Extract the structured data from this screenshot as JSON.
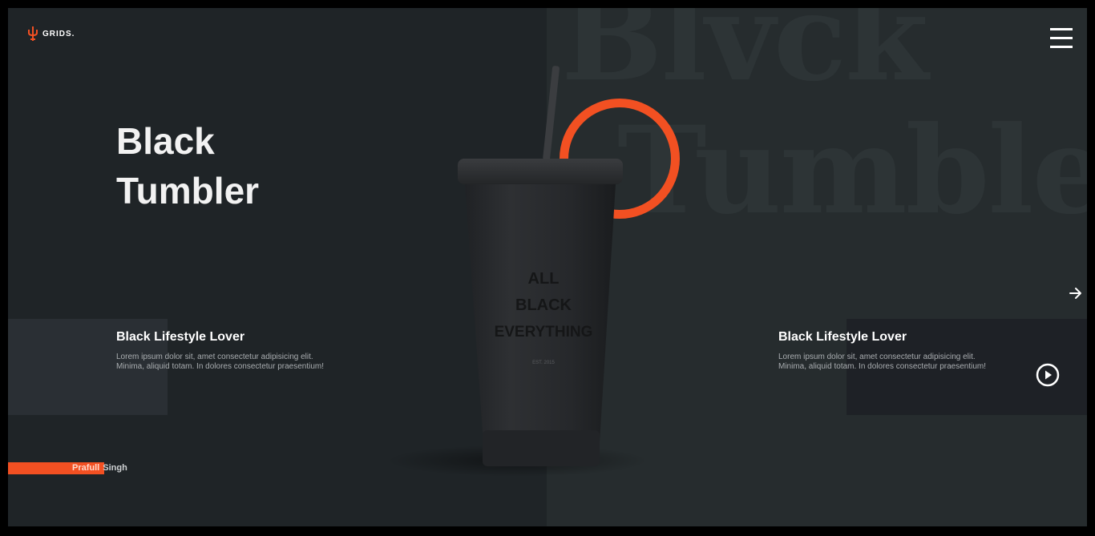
{
  "brand": {
    "name": "GRIDS.",
    "accent_color": "#f25022"
  },
  "background_words": [
    "Blvck",
    "Tumbler"
  ],
  "hero": {
    "title_line1": "Black",
    "title_line2": "Tumbler"
  },
  "product": {
    "print_line1": "ALL",
    "print_line2": "BLACK",
    "print_line3": "EVERYTHING",
    "print_small": "EST. 2015"
  },
  "features": [
    {
      "title": "Black Lifestyle Lover",
      "text": "Lorem ipsum dolor sit, amet consectetur adipisicing elit. Minima, aliquid totam. In dolores consectetur praesentium!"
    },
    {
      "title": "Black Lifestyle Lover",
      "text": "Lorem ipsum dolor sit, amet consectetur adipisicing elit. Minima, aliquid totam. In dolores consectetur praesentium!"
    }
  ],
  "author": {
    "first_name": "Prafull",
    "last_name": "Singh"
  },
  "icons": {
    "menu": "hamburger-menu-icon",
    "next": "arrow-right-icon",
    "play": "play-circle-icon",
    "logo": "trident-logo-icon"
  }
}
